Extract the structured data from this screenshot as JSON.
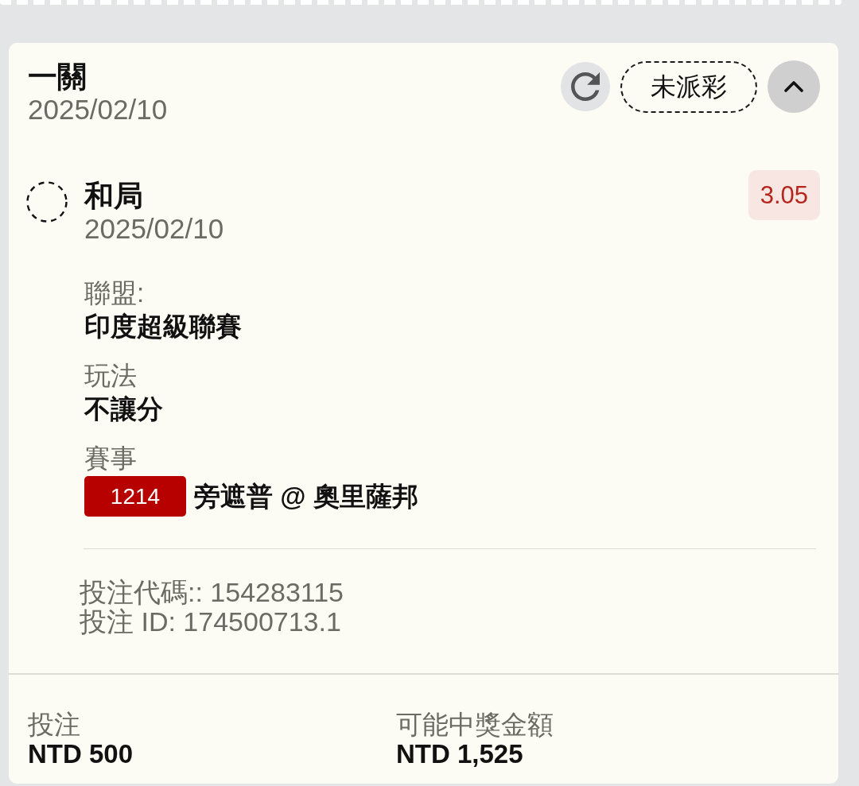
{
  "header": {
    "title": "一關",
    "date": "2025/02/10",
    "status": "未派彩",
    "expanded": true
  },
  "selection": {
    "name": "和局",
    "date": "2025/02/10",
    "odds": "3.05",
    "details": [
      {
        "kind": "text",
        "label": "聯盟:",
        "value": "印度超級聯賽"
      },
      {
        "kind": "text",
        "label": "玩法",
        "value": "不讓分"
      },
      {
        "kind": "event",
        "label": "賽事",
        "code": "1214",
        "value": "旁遮普 @ 奧里薩邦"
      }
    ],
    "references": [
      "投注代碼:: 154283115",
      "投注 ID: 174500713.1"
    ]
  },
  "summary": [
    {
      "label": "投注",
      "value": "NTD 500"
    },
    {
      "label": "可能中獎金額",
      "value": "NTD 1,525"
    }
  ]
}
